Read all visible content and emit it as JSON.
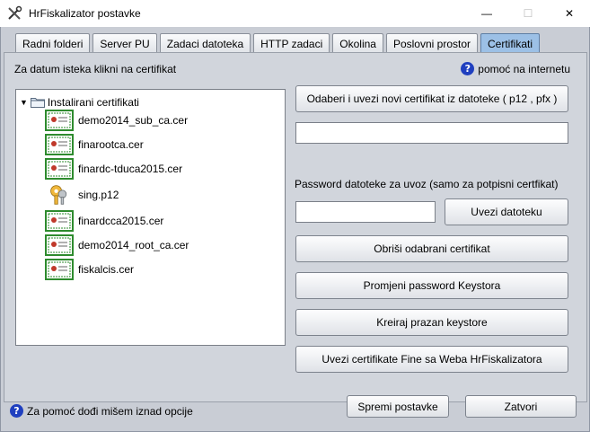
{
  "window": {
    "title": "HrFiskalizator postavke",
    "controls": {
      "minimize": "—",
      "maximize": "☐",
      "close": "✕"
    }
  },
  "tabs": [
    {
      "label": "Radni folderi",
      "active": false
    },
    {
      "label": "Server PU",
      "active": false
    },
    {
      "label": "Zadaci datoteka",
      "active": false
    },
    {
      "label": "HTTP zadaci",
      "active": false
    },
    {
      "label": "Okolina",
      "active": false
    },
    {
      "label": "Poslovni prostor",
      "active": false
    },
    {
      "label": "Certifikati",
      "active": true
    }
  ],
  "certificates": {
    "hint": "Za datum isteka klikni na certifikat",
    "help_link": "pomoć na internetu",
    "tree": {
      "root_label": "Instalirani certifikati",
      "items": [
        {
          "label": "demo2014_sub_ca.cer",
          "icon": "certificate-icon"
        },
        {
          "label": "finarootca.cer",
          "icon": "certificate-icon"
        },
        {
          "label": "finardc-tducа2015.cer",
          "icon": "certificate-icon"
        },
        {
          "label": "sing.p12",
          "icon": "keys-icon"
        },
        {
          "label": "finardcca2015.cer",
          "icon": "certificate-icon"
        },
        {
          "label": "demo2014_root_ca.cer",
          "icon": "certificate-icon"
        },
        {
          "label": "fiskalcis.cer",
          "icon": "certificate-icon"
        }
      ]
    },
    "choose_file_button": "Odaberi i uvezi novi certifikat iz datoteke (  p12 , pfx )",
    "file_path_value": "",
    "password_label": "Password datoteke za uvoz (samo za potpisni certfikat)",
    "password_value": "",
    "import_file_button": "Uvezi datoteku",
    "delete_button": "Obriši odabrani certifikat",
    "change_password_button": "Promjeni password Keystora",
    "create_keystore_button": "Kreiraj prazan keystore",
    "import_fina_button": "Uvezi certifikate Fine sa Weba HrFiskalizatora"
  },
  "footer": {
    "hint": "Za pomoć dođi mišem iznad opcije",
    "save_button": "Spremi postavke",
    "close_button": "Zatvori"
  },
  "colors": {
    "active_tab": "#9cc0e6",
    "help_icon": "#1f3fbf",
    "certificate_green": "#2e8b2e"
  }
}
